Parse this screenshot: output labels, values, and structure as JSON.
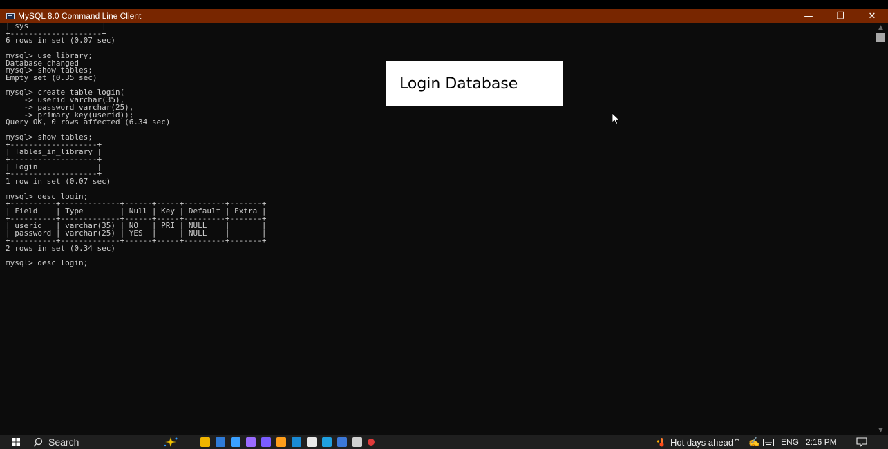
{
  "window": {
    "title": "MySQL 8.0 Command Line Client",
    "controls": {
      "minimize": "—",
      "restore": "❐",
      "close": "✕"
    }
  },
  "console": {
    "lines": [
      "| sys                |",
      "+--------------------+",
      "6 rows in set (0.07 sec)",
      "",
      "mysql> use library;",
      "Database changed",
      "mysql> show tables;",
      "Empty set (0.35 sec)",
      "",
      "mysql> create table login(",
      "    -> userid varchar(35),",
      "    -> password varchar(25),",
      "    -> primary key(userid));",
      "Query OK, 0 rows affected (6.34 sec)",
      "",
      "mysql> show tables;",
      "+-------------------+",
      "| Tables_in_library |",
      "+-------------------+",
      "| login             |",
      "+-------------------+",
      "1 row in set (0.07 sec)",
      "",
      "mysql> desc login;",
      "+----------+-------------+------+-----+---------+-------+",
      "| Field    | Type        | Null | Key | Default | Extra |",
      "+----------+-------------+------+-----+---------+-------+",
      "| userid   | varchar(35) | NO   | PRI | NULL    |       |",
      "| password | varchar(25) | YES  |     | NULL    |       |",
      "+----------+-------------+------+-----+---------+-------+",
      "2 rows in set (0.34 sec)",
      "",
      "mysql> desc login;"
    ]
  },
  "overlay": {
    "label": "Login Database"
  },
  "taskbar": {
    "search_label": "Search",
    "weather": "Hot days ahead",
    "language": "ENG",
    "time": "2:16 PM",
    "icon_colors": [
      "#f0b400",
      "#2f7bd8",
      "#3aa0ff",
      "#9a6bff",
      "#7a5cff",
      "#ff9e1b",
      "#1a8ad4",
      "#e8e8e8",
      "#1fa0e0",
      "#3c78d8",
      "#d0d0d0",
      "#e03a3a"
    ]
  }
}
